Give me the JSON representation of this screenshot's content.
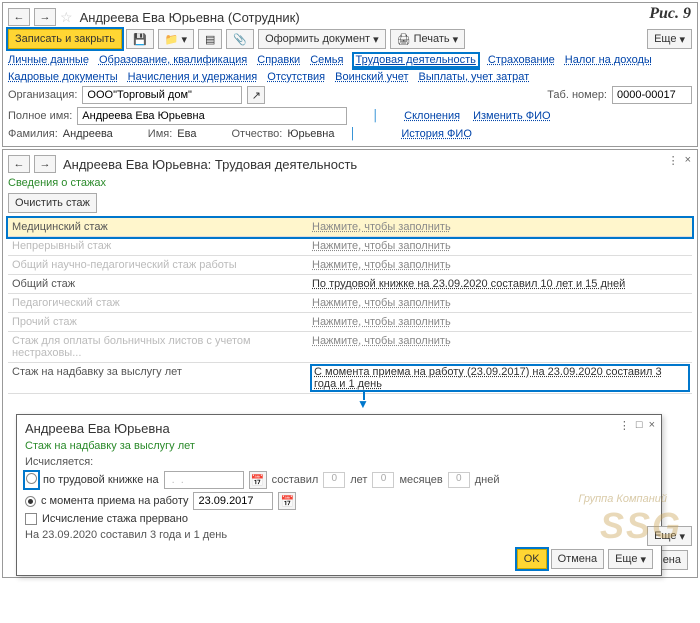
{
  "fig": "Рис. 9",
  "top": {
    "title": "Андреева Ева Юрьевна (Сотрудник)",
    "save_close": "Записать и закрыть",
    "doc": "Оформить документ",
    "print": "Печать",
    "more": "Еще",
    "tabs1": [
      "Личные данные",
      "Образование, квалификация",
      "Справки",
      "Семья",
      "Трудовая деятельность",
      "Страхование",
      "Налог на доходы"
    ],
    "tabs2": [
      "Кадровые документы",
      "Начисления и удержания",
      "Отсутствия",
      "Воинский учет",
      "Выплаты, учет затрат"
    ],
    "org_label": "Организация:",
    "org_value": "ООО\"Торговый дом\"",
    "tab_label": "Таб. номер:",
    "tab_value": "0000-00017",
    "fullname_label": "Полное имя:",
    "fullname_value": "Андреева Ева Юрьевна",
    "sklon": "Склонения",
    "change_fio": "Изменить ФИО",
    "surname_label": "Фамилия:",
    "surname_value": "Андреева",
    "name_label": "Имя:",
    "name_value": "Ева",
    "patr_label": "Отчество:",
    "patr_value": "Юрьевна",
    "history_fio": "История ФИО"
  },
  "mid": {
    "title": "Андреева Ева Юрьевна: Трудовая деятельность",
    "section": "Сведения о стажах",
    "clear": "Очистить стаж",
    "rows": [
      {
        "label": "Медицинский стаж",
        "value": "Нажмите, чтобы заполнить",
        "dim": false,
        "hl": true
      },
      {
        "label": "Непрерывный стаж",
        "value": "Нажмите, чтобы заполнить",
        "dim": true
      },
      {
        "label": "Общий научно-педагогический стаж работы",
        "value": "Нажмите, чтобы заполнить",
        "dim": true
      },
      {
        "label": "Общий стаж",
        "value": "По трудовой книжке на 23.09.2020 составил 10 лет и 15 дней",
        "dim": false,
        "strong": true
      },
      {
        "label": "Педагогический стаж",
        "value": "Нажмите, чтобы заполнить",
        "dim": true
      },
      {
        "label": "Прочий стаж",
        "value": "Нажмите, чтобы заполнить",
        "dim": true
      },
      {
        "label": "Стаж для оплаты больничных листов с учетом нестраховы...",
        "value": "Нажмите, чтобы заполнить",
        "dim": true
      },
      {
        "label": "Стаж на надбавку за выслугу лет",
        "value": "С момента приема на работу (23.09.2017) на 23.09.2020 составил 3 года и 1 день",
        "dim": false,
        "strong": true,
        "hlval": true
      }
    ],
    "more": "Еще"
  },
  "popup": {
    "title": "Андреева Ева Юрьевна",
    "subtitle": "Стаж на надбавку за выслугу лет",
    "calc": "Исчисляется:",
    "r1": "по трудовой книжке на",
    "made": "составил",
    "yrs": "лет",
    "mon": "месяцев",
    "days": "дней",
    "zero": "0",
    "r2": "с момента приема на работу",
    "date": "23.09.2017",
    "chk": "Исчисление стажа прервано",
    "summary": "На 23.09.2020 составил 3 года и 1 день",
    "ok": "OK",
    "cancel": "Отмена",
    "more": "Еще"
  },
  "footer": {
    "ok": "OK",
    "cancel": "Отмена"
  },
  "wm": {
    "big": "SSG",
    "small": "Группа Компаний"
  }
}
